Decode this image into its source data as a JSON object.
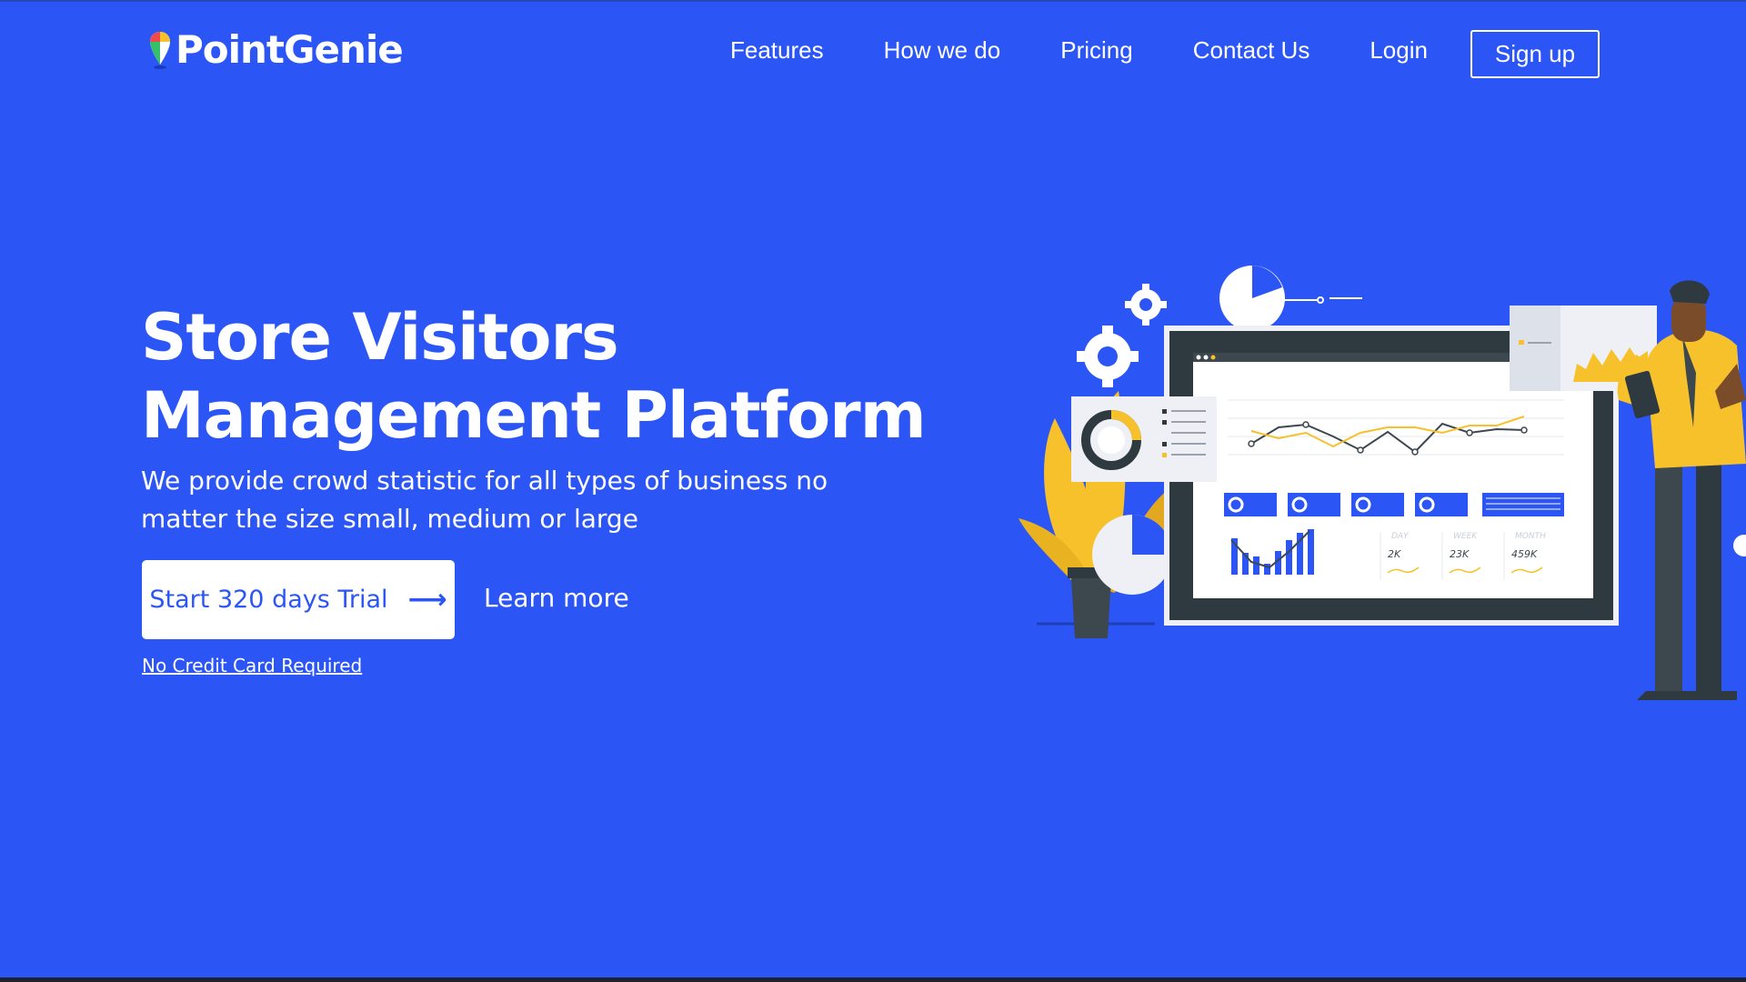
{
  "header": {
    "logo_text": "PointGenie",
    "nav": [
      "Features",
      "How we do",
      "Pricing",
      "Contact Us",
      "Login"
    ],
    "signup_label": "Sign up"
  },
  "hero": {
    "title_line1": "Store Visitors",
    "title_line2": "Management Platform",
    "subtitle": "We provide crowd statistic for all types of business no matter the size small, medium or large",
    "cta_label": "Start 320 days Trial",
    "learn_more": "Learn more",
    "no_credit_card": "No Credit Card Required"
  },
  "illustration": {
    "stats": [
      {
        "label": "DAY",
        "value": "2K"
      },
      {
        "label": "WEEK",
        "value": "23K"
      },
      {
        "label": "MONTH",
        "value": "459K"
      }
    ]
  },
  "colors": {
    "background": "#2b56f5",
    "accent_yellow": "#f6c12b",
    "dark": "#2f3a40"
  },
  "icons": [
    "map-pin-icon",
    "arrow-right-icon",
    "gear-icon"
  ]
}
